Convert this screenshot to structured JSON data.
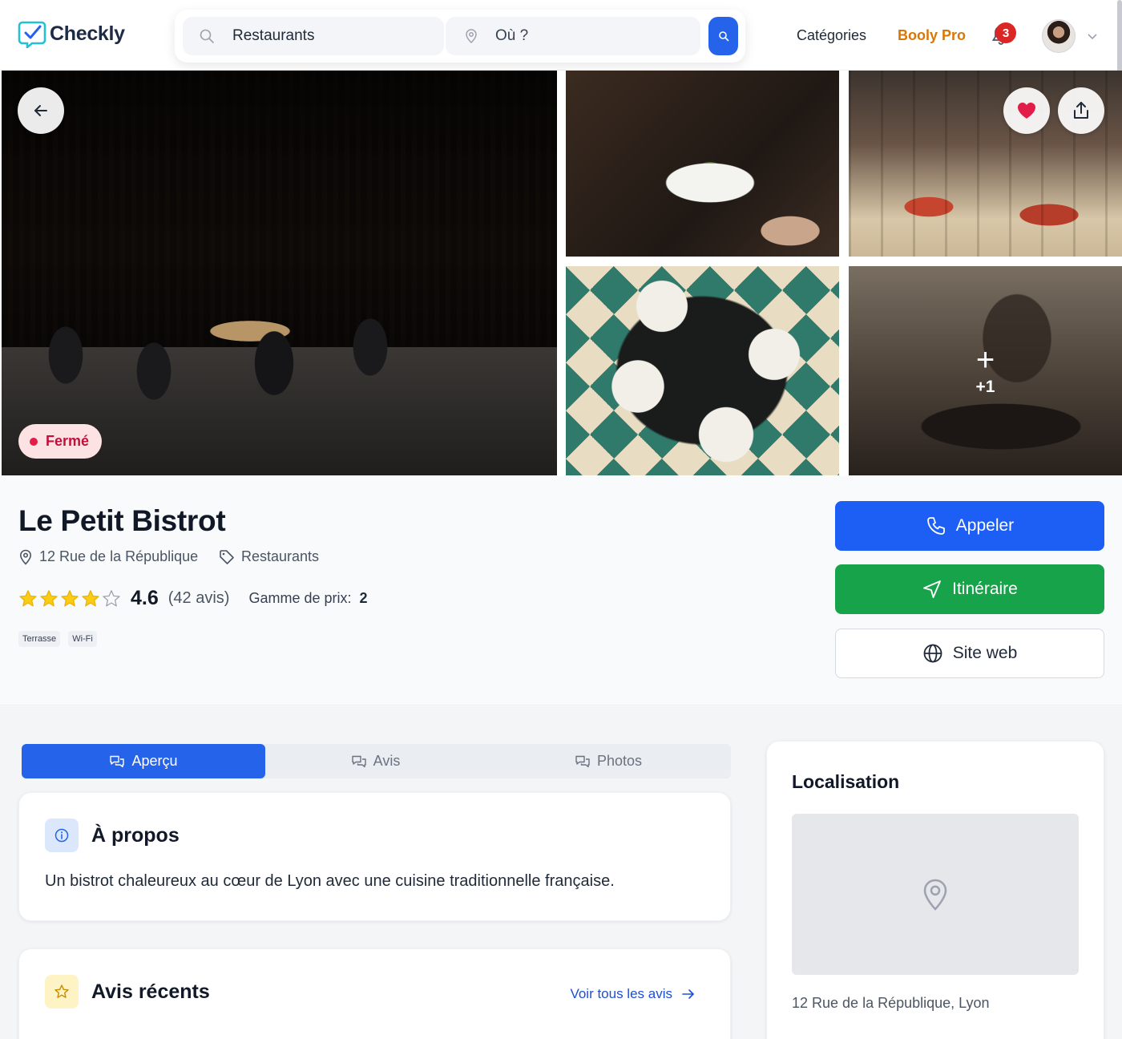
{
  "header": {
    "logo_text": "Checkly",
    "search_what_value": "Restaurants",
    "search_where_placeholder": "Où ?",
    "nav_categories": "Catégories",
    "nav_pro": "Booly Pro",
    "notification_count": "3"
  },
  "gallery": {
    "status": "Fermé",
    "more_photos_plus": "+",
    "more_photos_count": "+1"
  },
  "place": {
    "name": "Le Petit Bistrot",
    "address": "12 Rue de la République",
    "category": "Restaurants",
    "rating_value": "4.6",
    "rating_stars": 4.6,
    "rating_max": 5,
    "review_count": "(42 avis)",
    "price_label": "Gamme de prix:",
    "price_value": "2",
    "tags": [
      "Terrasse",
      "Wi-Fi"
    ]
  },
  "actions": {
    "call": "Appeler",
    "route": "Itinéraire",
    "website": "Site web"
  },
  "tabs": [
    "Aperçu",
    "Avis",
    "Photos"
  ],
  "about": {
    "title": "À propos",
    "text": "Un bistrot chaleureux au cœur de Lyon avec une cuisine traditionnelle française."
  },
  "reviews": {
    "title": "Avis récents",
    "link": "Voir tous les avis"
  },
  "location": {
    "title": "Localisation",
    "address": "12 Rue de la République, Lyon"
  },
  "colors": {
    "primary": "#2563eb",
    "call_button": "#1d5ff5",
    "route_button": "#16a34a",
    "pro_link": "#d97706",
    "closed_status": "#e11d48",
    "star": "#facc15"
  }
}
